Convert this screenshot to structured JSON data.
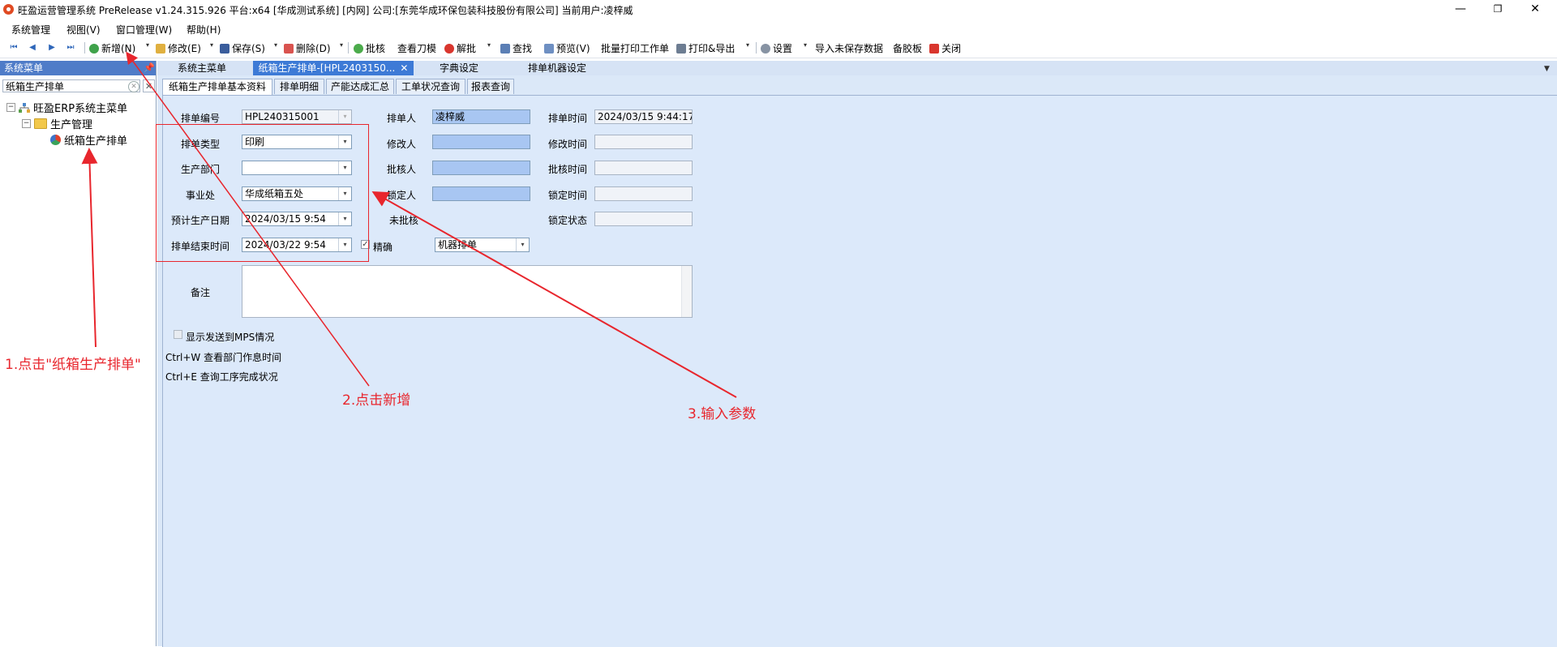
{
  "window": {
    "title": "旺盈运营管理系统 PreRelease v1.24.315.926 平台:x64  [华成测试系统] [内网] 公司:[东莞华成环保包装科技股份有限公司] 当前用户:凌梓威",
    "minimize": "—",
    "restore": "❐",
    "close": "✕"
  },
  "menu": [
    "系统管理",
    "视图(V)",
    "窗口管理(W)",
    "帮助(H)"
  ],
  "toolbar": {
    "new": "新增(N)",
    "edit": "修改(E)",
    "save": "保存(S)",
    "delete": "删除(D)",
    "approve": "批核",
    "view_die": "查看刀模",
    "unapprove": "解批",
    "find": "查找",
    "preview": "预览(V)",
    "batch_print": "批量打印工作单",
    "print_export": "打印&导出",
    "settings": "设置",
    "import_unsaved": "导入未保存数据",
    "backup": "备胶板",
    "close": "关闭"
  },
  "sidebar": {
    "title": "系统菜单",
    "search_value": "纸箱生产排单",
    "tree": {
      "root": "旺盈ERP系统主菜单",
      "group": "生产管理",
      "leaf": "纸箱生产排单"
    }
  },
  "doc_tabs": [
    {
      "label": "系统主菜单"
    },
    {
      "label": "纸箱生产排单-[HPL2403150...",
      "close": "✕"
    },
    {
      "label": "字典设定"
    },
    {
      "label": "排单机器设定"
    }
  ],
  "sub_tabs": [
    "纸箱生产排单基本资料",
    "排单明细",
    "产能达成汇总",
    "工单状况查询",
    "报表查询"
  ],
  "form": {
    "labels": {
      "order_no": "排单编号",
      "order_type": "排单类型",
      "dept": "生产部门",
      "division": "事业处",
      "plan_date": "预计生产日期",
      "end_time": "排单结束时间",
      "scheduler": "排单人",
      "modifier": "修改人",
      "approver": "批核人",
      "locker": "锁定人",
      "unapproved": "未批核",
      "precise": "精确",
      "sched_time": "排单时间",
      "modify_time": "修改时间",
      "approve_time": "批核时间",
      "lock_time": "锁定时间",
      "lock_status": "锁定状态",
      "remarks": "备注"
    },
    "values": {
      "order_no": "HPL240315001",
      "order_type": "印刷",
      "dept": "",
      "division": "华成纸箱五处",
      "plan_date": "2024/03/15 9:54",
      "end_time": "2024/03/22 9:54",
      "scheduler": "凌梓威",
      "sched_time": "2024/03/15 9:44:17",
      "machine_mode": "机器排单"
    },
    "show_mps": "显示发送到MPS情况",
    "hint1": "Ctrl+W 查看部门作息时间",
    "hint2": "Ctrl+E  查询工序完成状况"
  },
  "annotations": {
    "step1": "1.点击\"纸箱生产排单\"",
    "step2": "2.点击新增",
    "step3": "3.输入参数",
    "color": "#e8262d"
  }
}
